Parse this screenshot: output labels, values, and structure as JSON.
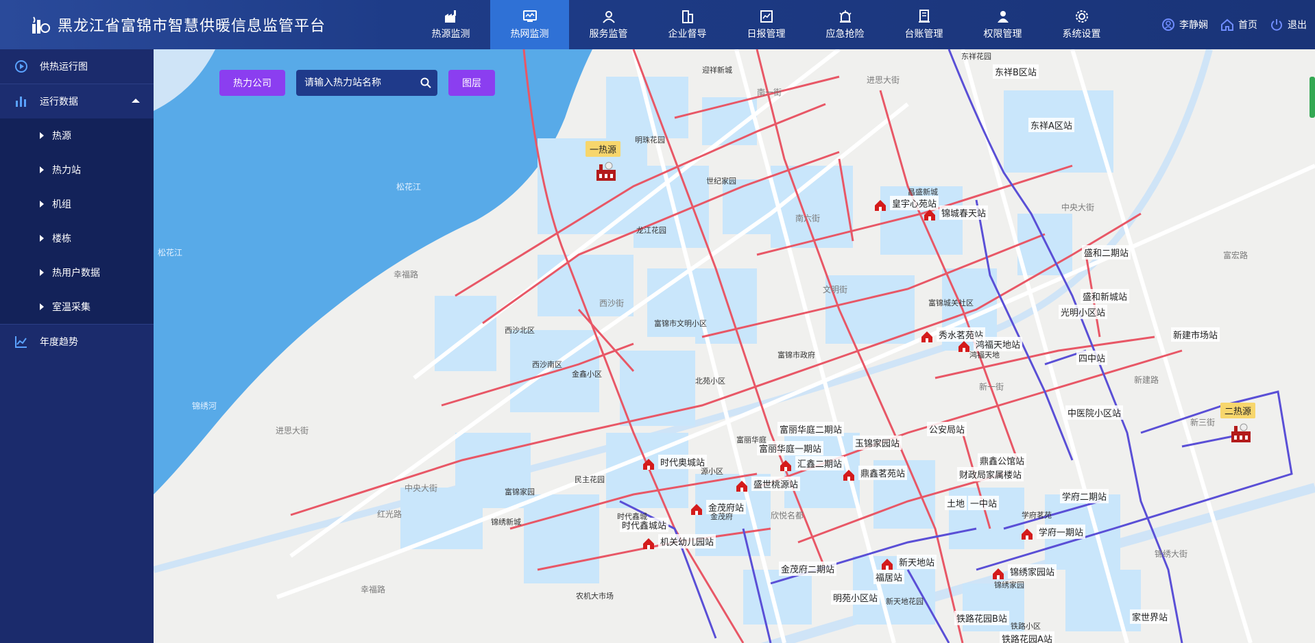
{
  "app": {
    "title": "黑龙江省富锦市智慧供暖信息监管平台"
  },
  "nav": [
    {
      "label": "热源监测",
      "icon": "factory-icon"
    },
    {
      "label": "热网监测",
      "icon": "monitor-icon"
    },
    {
      "label": "服务监管",
      "icon": "service-icon"
    },
    {
      "label": "企业督导",
      "icon": "building-icon"
    },
    {
      "label": "日报管理",
      "icon": "report-icon"
    },
    {
      "label": "应急抢险",
      "icon": "alarm-icon"
    },
    {
      "label": "台账管理",
      "icon": "ledger-icon"
    },
    {
      "label": "权限管理",
      "icon": "user-icon"
    },
    {
      "label": "系统设置",
      "icon": "gear-icon"
    }
  ],
  "active_nav": "热网监测",
  "user": {
    "name": "李静娴",
    "home": "首页",
    "logout": "退出"
  },
  "sidebar": {
    "items": [
      {
        "label": "供热运行图"
      },
      {
        "label": "运行数据"
      },
      {
        "label": "年度趋势"
      }
    ],
    "sub_items": [
      {
        "label": "热源"
      },
      {
        "label": "热力站"
      },
      {
        "label": "机组"
      },
      {
        "label": "楼栋"
      },
      {
        "label": "热用户数据"
      },
      {
        "label": "室温采集"
      }
    ]
  },
  "toolbar": {
    "company_button": "热力公司",
    "search_placeholder": "请输入热力站名称",
    "layer_button": "图层"
  },
  "heat_sources": [
    {
      "tag": "一热源"
    },
    {
      "tag": "二热源"
    }
  ],
  "stations_gray": [
    "东祥B区站",
    "东祥A区站",
    "盛和二期站",
    "盛和新城站",
    "光明小区站",
    "新建市场站",
    "四中站",
    "中医院小区站",
    "富丽华庭二期站",
    "富丽华庭一期站",
    "玉锦家园站",
    "公安局站",
    "鼎鑫公馆站",
    "财政局家属楼站",
    "土地",
    "一中站",
    "学府二期站",
    "时代鑫城站",
    "金茂府二期站",
    "福居站",
    "明苑小区站",
    "铁路花园B站",
    "铁路花园A站",
    "家世界站"
  ],
  "stations_red": [
    "皇宇心苑站",
    "锦城春天站",
    "秀水茗苑站",
    "鸿福天地站",
    "时代奥城站",
    "汇鑫二期站",
    "鼎鑫茗苑站",
    "盛世桃源站",
    "金茂府站",
    "机关幼儿园站",
    "学府一期站",
    "新天地站",
    "锦绣家园站"
  ],
  "pois": [
    "迎祥新城",
    "明珠花园",
    "世纪家园",
    "龙江花园",
    "西沙北区",
    "西沙南区",
    "金鑫小区",
    "富锦市文明小区",
    "北苑小区",
    "富锦市政府",
    "民主花园",
    "富锦家园",
    "锦绣新城",
    "时代鑫城",
    "金茂府",
    "农机大市场",
    "昌盛新城",
    "富锦城关社区",
    "东祥花园",
    "鸿福天地",
    "学府茗苑",
    "新天地花园",
    "锦绣家园",
    "铁路小区",
    "富丽华庭",
    "源小区",
    "欣悦名都"
  ],
  "roads": [
    "南一街",
    "进思大街",
    "西沙街",
    "幸福路",
    "中央大街",
    "文明街",
    "南六街",
    "新一街",
    "新三街",
    "中央大街",
    "锦绣大街",
    "富宏路",
    "新建路",
    "红光路",
    "幸福路",
    "进思大街",
    "松花江"
  ],
  "rivers": [
    "松花江",
    "松花江",
    "锦绣河"
  ],
  "colors": {
    "topbar": "#1e3c88",
    "active_nav": "#2f71d6",
    "sidebar": "#1b2b6c",
    "river": "#58aae8",
    "block": "#c9e6fb",
    "pipe_red": "#e85766",
    "pipe_blue": "#5a4fd6",
    "button": "#8b3ef0"
  }
}
